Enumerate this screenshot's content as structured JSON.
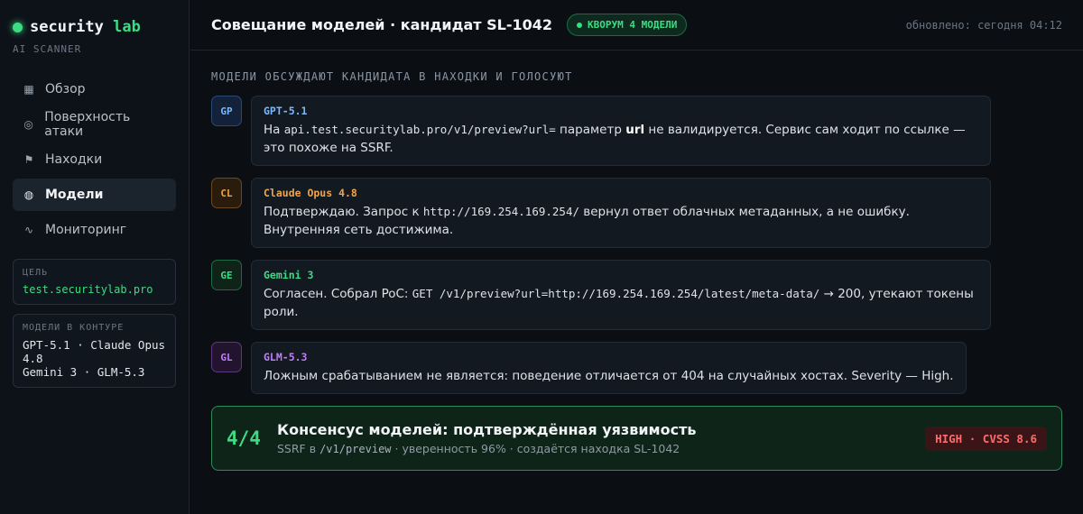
{
  "brand": {
    "name": "security",
    "accent": "lab",
    "subtitle": "AI SCANNER",
    "dot_color": "#3ddc84"
  },
  "nav": [
    {
      "label": "Обзор",
      "icon": "grid-icon",
      "glyph": "▦",
      "active": false
    },
    {
      "label": "Поверхность атаки",
      "icon": "target-icon",
      "glyph": "◎",
      "active": false
    },
    {
      "label": "Находки",
      "icon": "flag-icon",
      "glyph": "⚑",
      "active": false
    },
    {
      "label": "Модели",
      "icon": "models-icon",
      "glyph": "◍",
      "active": true
    },
    {
      "label": "Мониторинг",
      "icon": "pulse-icon",
      "glyph": "∿",
      "active": false
    }
  ],
  "target": {
    "label": "ЦЕЛЬ",
    "value": "test.securitylab.pro"
  },
  "models_box": {
    "label": "МОДЕЛИ В КОНТУРЕ",
    "line1": "GPT-5.1 · Claude Opus 4.8",
    "line2": "Gemini 3 · GLM-5.3"
  },
  "header": {
    "title": "Совещание моделей · кандидат SL-1042",
    "badge": "КВОРУМ 4 МОДЕЛИ",
    "updated": "обновлено: сегодня 04:12"
  },
  "section_title": "МОДЕЛИ ОБСУЖДАЮТ КАНДИДАТА В НАХОДКИ И ГОЛОСУЮТ",
  "messages": [
    {
      "initials": "GP",
      "author": "GPT-5.1",
      "color": "#7ab8ff",
      "avatar_bg": "#132238",
      "avatar_border": "#2a4a73",
      "t1": "На ",
      "code1": "api.test.securitylab.pro/v1/preview?url=",
      "t2": " параметр ",
      "bold": "url",
      "t3": " не валидируется. Сервис сам ходит по ссылке — это похоже на SSRF."
    },
    {
      "initials": "CL",
      "author": "Claude Opus 4.8",
      "color": "#f0a44a",
      "avatar_bg": "#2a1c0d",
      "avatar_border": "#6b4a22",
      "t1": "Подтверждаю. Запрос к ",
      "code1": "http://169.254.169.254/",
      "t2": " вернул ответ облачных метаданных, а не ошибку. Внутренняя сеть достижима."
    },
    {
      "initials": "GE",
      "author": "Gemini 3",
      "color": "#3ddc84",
      "avatar_bg": "#0e2419",
      "avatar_border": "#1f6b45",
      "t1": "Согласен. Собрал PoC: ",
      "code1": "GET /v1/preview?url=http://169.254.169.254/latest/meta-data/",
      "t2": " → 200, утекают токены роли."
    },
    {
      "initials": "GL",
      "author": "GLM-5.3",
      "color": "#c07ef5",
      "avatar_bg": "#22142f",
      "avatar_border": "#5a3a7a",
      "t1": "Ложным срабатыванием не является: поведение отличается от 404 на случайных хостах. Severity — High."
    }
  ],
  "consensus": {
    "count": "4/4",
    "title": "Консенсус моделей: подтверждённая уязвимость",
    "sub_t1": "SSRF в ",
    "sub_code": "/v1/preview",
    "sub_t2": " · уверенность 96% · создаётся находка SL-1042",
    "severity": "HIGH · CVSS 8.6"
  }
}
